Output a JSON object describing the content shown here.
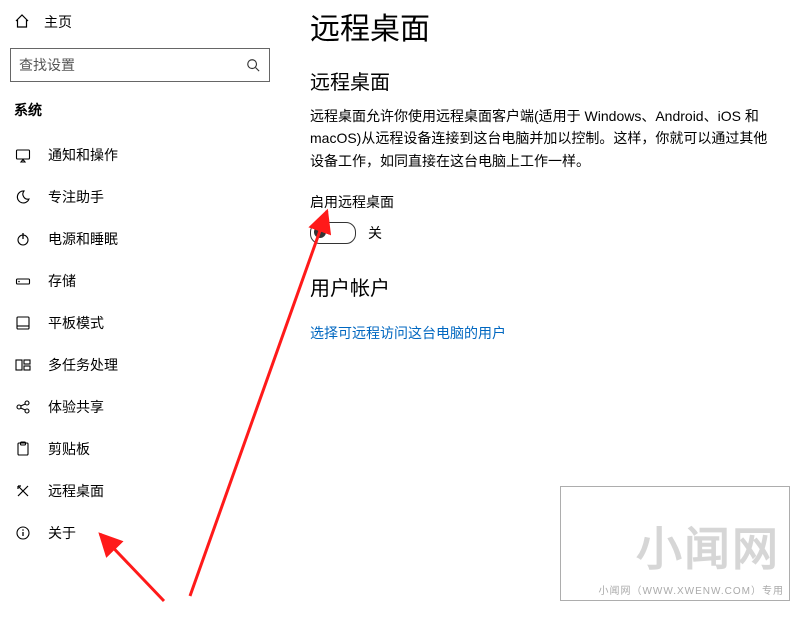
{
  "sidebar": {
    "home_label": "主页",
    "search_placeholder": "查找设置",
    "category": "系统",
    "items": [
      {
        "label": "通知和操作"
      },
      {
        "label": "专注助手"
      },
      {
        "label": "电源和睡眠"
      },
      {
        "label": "存储"
      },
      {
        "label": "平板模式"
      },
      {
        "label": "多任务处理"
      },
      {
        "label": "体验共享"
      },
      {
        "label": "剪贴板"
      },
      {
        "label": "远程桌面"
      },
      {
        "label": "关于"
      }
    ]
  },
  "main": {
    "page_title": "远程桌面",
    "section1_heading": "远程桌面",
    "description": "远程桌面允许你使用远程桌面客户端(适用于 Windows、Android、iOS 和 macOS)从远程设备连接到这台电脑并加以控制。这样，你就可以通过其他设备工作，如同直接在这台电脑上工作一样。",
    "enable_label": "启用远程桌面",
    "toggle_state": "关",
    "section2_heading": "用户帐户",
    "select_users_link": "选择可远程访问这台电脑的用户"
  },
  "watermark": {
    "big": "小闻网",
    "small": "小闻网（WWW.XWENW.COM）专用"
  }
}
